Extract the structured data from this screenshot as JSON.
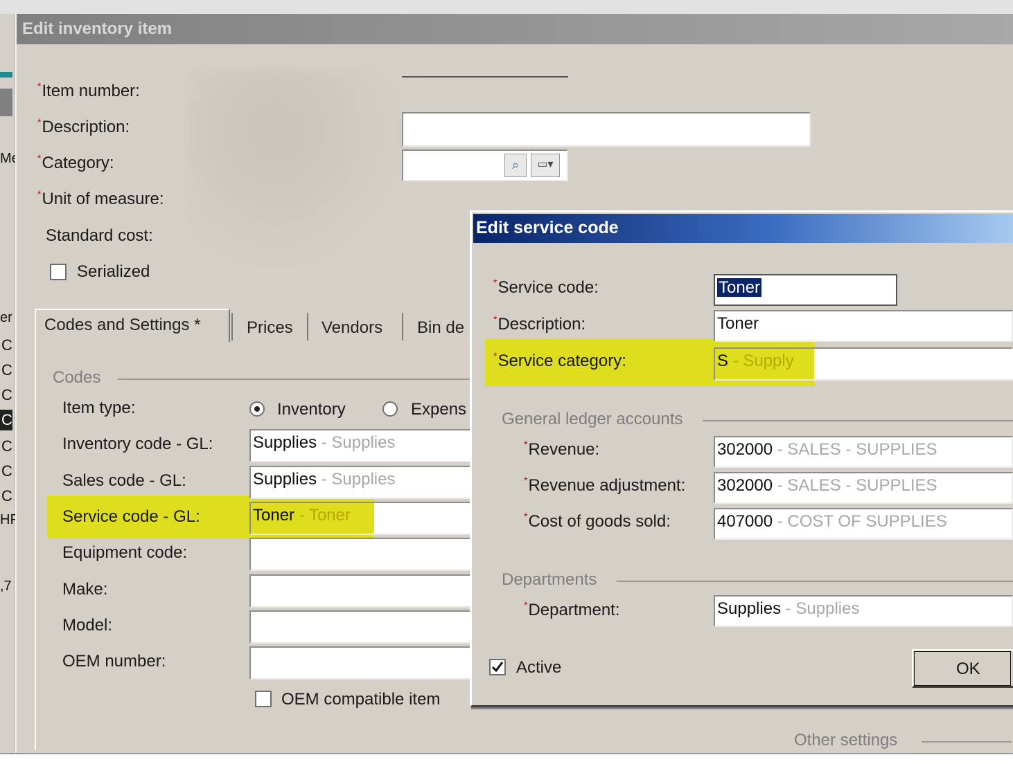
{
  "colors": {
    "window_bg": "#d4d0c8",
    "title_gray": "#888888",
    "dialog_blue_start": "#0a246a",
    "dialog_blue_end": "#a6caf0",
    "required_asterisk": "#d40000",
    "highlight": "#e1e100"
  },
  "edit_item": {
    "title": "Edit inventory item",
    "labels": {
      "item_number": "Item number:",
      "description": "Description:",
      "category": "Category:",
      "unit_of_measure": "Unit of measure:",
      "standard_cost": "Standard cost:"
    },
    "serialized_label": "Serialized",
    "serialized_checked": false,
    "tabs": [
      "Codes and Settings *",
      "Prices",
      "Vendors",
      "Bin de"
    ],
    "codes": {
      "group_label": "Codes",
      "item_type_label": "Item type:",
      "item_type_options": [
        "Inventory",
        "Expens"
      ],
      "item_type_selected": "Inventory",
      "inventory_code_label": "Inventory code - GL:",
      "inventory_code": {
        "code": "Supplies",
        "desc": "- Supplies"
      },
      "sales_code_label": "Sales code - GL:",
      "sales_code": {
        "code": "Supplies",
        "desc": "- Supplies"
      },
      "service_code_label": "Service code - GL:",
      "service_code": {
        "code": "Toner",
        "desc": "- Toner"
      },
      "equipment_code_label": "Equipment code:",
      "make_label": "Make:",
      "model_label": "Model:",
      "oem_number_label": "OEM number:",
      "oem_compatible_label": "OEM compatible item",
      "oem_compatible_checked": false
    },
    "other_settings_label": "Other settings"
  },
  "service_dialog": {
    "title": "Edit service code",
    "service_code_label": "Service code:",
    "service_code_value": "Toner",
    "description_label": "Description:",
    "description_value": "Toner",
    "service_category_label": "Service category:",
    "service_category": {
      "code": "S",
      "desc": "- Supply"
    },
    "gl_group_label": "General ledger accounts",
    "revenue_label": "Revenue:",
    "revenue": {
      "code": "302000",
      "desc": "- SALES - SUPPLIES"
    },
    "revenue_adjustment_label": "Revenue adjustment:",
    "revenue_adjustment": {
      "code": "302000",
      "desc": "- SALES - SUPPLIES"
    },
    "cogs_label": "Cost of goods sold:",
    "cogs": {
      "code": "407000",
      "desc": "- COST OF SUPPLIES"
    },
    "departments_group_label": "Departments",
    "department_label": "Department:",
    "department": {
      "code": "Supplies",
      "desc": "- Supplies"
    },
    "active_label": "Active",
    "active_checked": true,
    "ok_label": "OK"
  },
  "left_edge_fragments": [
    "er",
    "C",
    "C",
    "C",
    "C",
    "C",
    "C",
    "C",
    "HP",
    ",7",
    "Me"
  ]
}
